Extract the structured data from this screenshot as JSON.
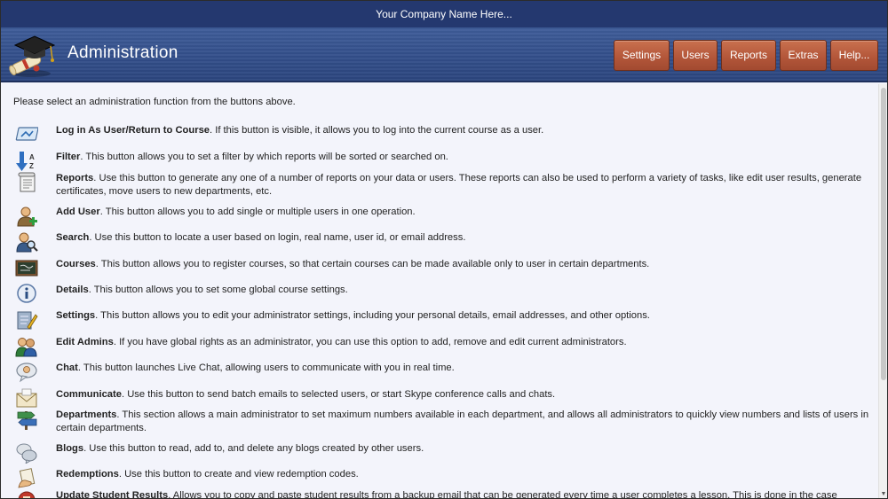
{
  "topbar": {
    "company": "Your Company Name Here..."
  },
  "header": {
    "title": "Administration"
  },
  "nav": [
    {
      "label": "Settings",
      "name": "settings"
    },
    {
      "label": "Users",
      "name": "users"
    },
    {
      "label": "Reports",
      "name": "reports"
    },
    {
      "label": "Extras",
      "name": "extras"
    },
    {
      "label": "Help...",
      "name": "help"
    }
  ],
  "intro": "Please select an administration function from the buttons above.",
  "items": [
    {
      "icon": "login-icon",
      "title": "Log in As User/Return to Course",
      "desc": ". If this button is visible, it allows you to log into the current course as a user."
    },
    {
      "icon": "sort-az-icon",
      "title": "Filter",
      "desc": ". This button allows you to set a filter by which reports will be sorted or searched on."
    },
    {
      "icon": "scroll-icon",
      "title": "Reports",
      "desc": ". Use this button to generate any one of a number of reports on your data or users. These reports can also be used to perform a variety of tasks, like edit user results, generate certificates, move users to new departments, etc."
    },
    {
      "icon": "add-user-icon",
      "title": "Add User",
      "desc": ". This button allows you to add single or multiple users in one operation."
    },
    {
      "icon": "user-search-icon",
      "title": "Search",
      "desc": ". Use this button to locate a user based on login, real name, user id, or email address."
    },
    {
      "icon": "blackboard-icon",
      "title": "Courses",
      "desc": ". This button allows you to register courses, so that certain courses can be made available only to user in certain departments."
    },
    {
      "icon": "info-icon",
      "title": "Details",
      "desc": ". This button allows you to set some global course settings."
    },
    {
      "icon": "settings-pencil-icon",
      "title": "Settings",
      "desc": ". This button allows you to edit your administrator settings, including your personal details, email addresses, and other options."
    },
    {
      "icon": "admins-icon",
      "title": "Edit Admins",
      "desc": ". If you have global rights as an administrator, you can use this option to add, remove and edit current administrators."
    },
    {
      "icon": "chat-icon",
      "title": "Chat",
      "desc": ". This button launches Live Chat, allowing users to communicate with you in real time."
    },
    {
      "icon": "envelope-icon",
      "title": "Communicate",
      "desc": ". Use this button to send batch emails to selected users, or start Skype conference calls and chats."
    },
    {
      "icon": "signpost-icon",
      "title": "Departments",
      "desc": ". This section allows a main administrator to set maximum numbers available in each department, and allows all administrators to quickly view numbers and lists of users in certain departments."
    },
    {
      "icon": "blogs-icon",
      "title": "Blogs",
      "desc": ". Use this button to read, add to, and delete any blogs created by other users."
    },
    {
      "icon": "redemption-icon",
      "title": "Redemptions",
      "desc": ". Use this button to create and view redemption codes."
    },
    {
      "icon": "update-results-icon",
      "title": "Update Student Results",
      "desc": ". Allows you to copy and paste student results from a backup email that can be generated every time a user completes a lesson. This is done in the case"
    }
  ]
}
